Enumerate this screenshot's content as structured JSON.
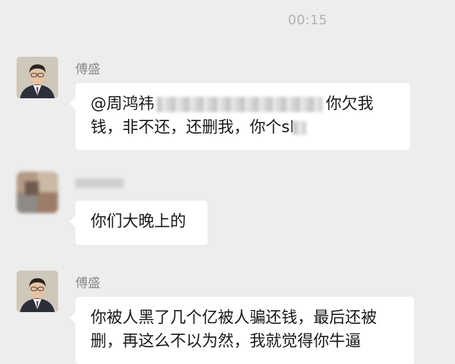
{
  "chat": {
    "timestamp": "00:15",
    "messages": [
      {
        "sender": "傅盛",
        "text_line1_a": "@周鸿祎",
        "text_line1_b": "你欠我",
        "text_line2": "钱，非不还，还删我，你个sl"
      },
      {
        "sender": "",
        "text": "你们大晚上的"
      },
      {
        "sender": "傅盛",
        "text_line1": "你被人黑了几个亿被人骗还钱，最后还被",
        "text_line2": "删，再这么不以为然，我就觉得你牛逼"
      }
    ]
  },
  "colors": {
    "background": "#ededed",
    "bubble": "#ffffff",
    "timestamp": "#b2b2b2",
    "sender_name": "#8a8a8a"
  },
  "icons": {
    "avatar_1": "person-portrait-avatar",
    "avatar_2": "blurred-avatar",
    "avatar_3": "person-portrait-avatar"
  }
}
